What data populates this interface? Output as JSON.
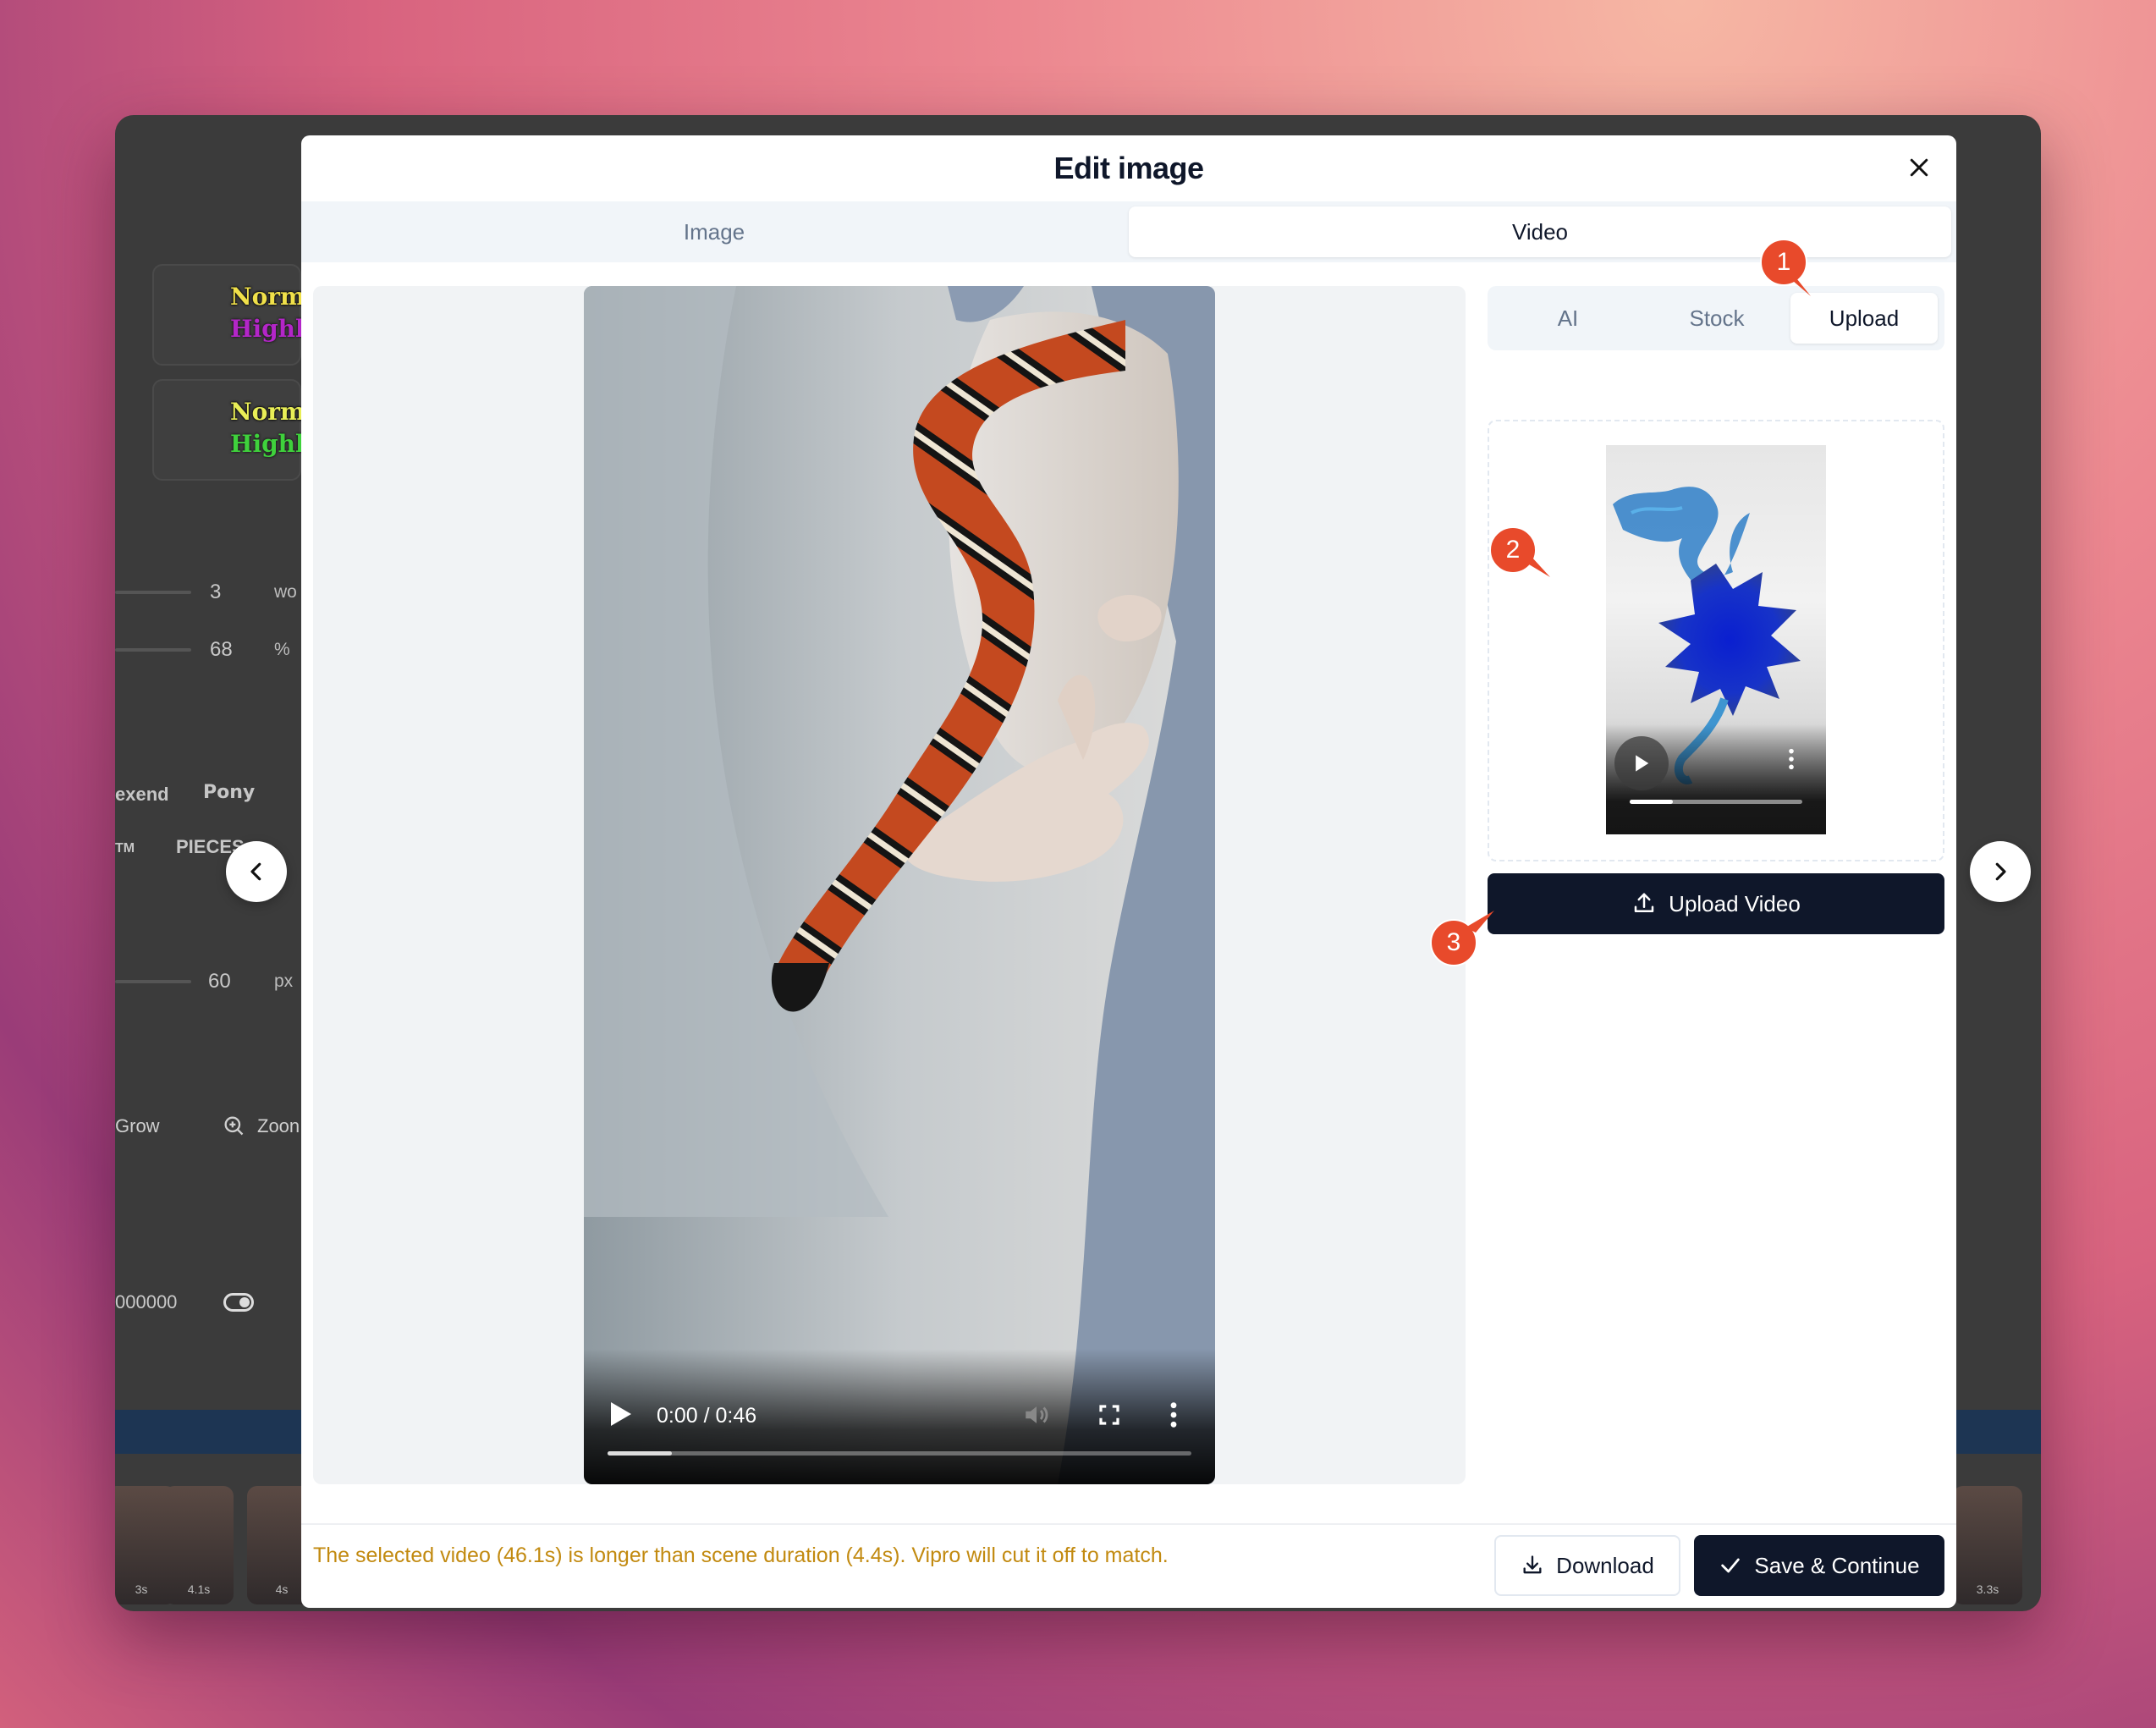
{
  "background_app": {
    "font_cards": [
      {
        "normal": "Normal",
        "highlight": "Highlight",
        "highlight_color": "#b326c8"
      },
      {
        "normal": "Normal",
        "highlight": "Highlight",
        "highlight_color": "#3fd13c"
      }
    ],
    "settings": [
      {
        "value": "3",
        "unit": "wo"
      },
      {
        "value": "68",
        "unit": "%"
      },
      {
        "value": "60",
        "unit": "px"
      }
    ],
    "font_names": [
      "exend",
      "Pony",
      "TM",
      "PIECES"
    ],
    "animations": [
      "Grow",
      "Zoon"
    ],
    "color_value": "000000",
    "thumbnail_durations": [
      "3s",
      "4.1s",
      "4s",
      "3.3s"
    ]
  },
  "modal": {
    "title": "Edit image",
    "tabs": [
      {
        "label": "Image",
        "active": false
      },
      {
        "label": "Video",
        "active": true
      }
    ],
    "video": {
      "time": "0:00 / 0:46",
      "progress": 0.11
    },
    "source_tabs": [
      {
        "label": "AI",
        "active": false
      },
      {
        "label": "Stock",
        "active": false
      },
      {
        "label": "Upload",
        "active": true
      }
    ],
    "uploaded_preview": {
      "progress": 0.25
    },
    "upload_button": "Upload Video",
    "warning": "The selected video (46.1s) is longer than scene duration (4.4s). Vipro will cut it off to match.",
    "download_button": "Download",
    "save_button": "Save & Continue"
  },
  "step_badges": [
    "1",
    "2",
    "3"
  ],
  "colors": {
    "primary": "#0f172a",
    "badge": "#e84a2b",
    "warning": "#c28a10",
    "muted_text": "#64748b"
  }
}
